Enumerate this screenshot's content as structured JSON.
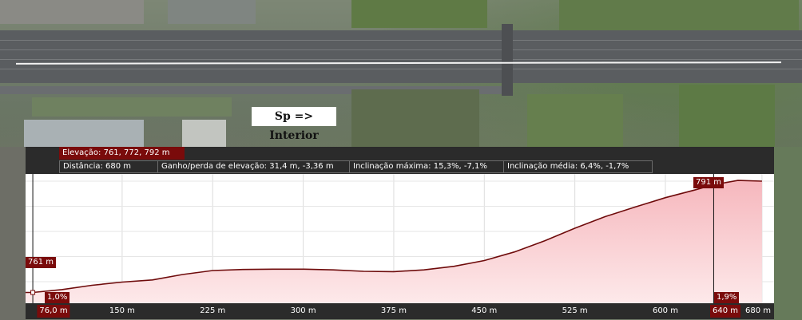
{
  "route_caption": "Sp  => Interior",
  "header": {
    "elevation": "Elevação: 761, 772, 792 m",
    "distance": "Distância: 680 m",
    "gain": "Ganho/perda de elevação: 31,4 m, -3,36 m",
    "max_slope": "Inclinação máxima: 15,3%, -7,1%",
    "avg_slope": "Inclinação média: 6,4%, -1,7%"
  },
  "markers": {
    "left_elevation": "761 m",
    "left_slope": "1,0%",
    "left_distance": "76,0 m",
    "right_elevation": "791 m",
    "right_slope": "1,9%",
    "right_distance": "640 m"
  },
  "chart_data": {
    "type": "area",
    "xlabel": "",
    "ylabel": "",
    "x_range": [
      70,
      690
    ],
    "x_ticks": [
      "150 m",
      "225 m",
      "300 m",
      "375 m",
      "450 m",
      "525 m",
      "600 m",
      "680 m"
    ],
    "x_tick_values": [
      150,
      225,
      300,
      375,
      450,
      525,
      600,
      680
    ],
    "y_range": [
      758,
      794
    ],
    "grid": true,
    "colors": {
      "line": "#6e0b0b",
      "fill_top": "#f6b7bd",
      "fill_bottom": "#fde9ea"
    },
    "series": [
      {
        "x": [
          76,
          100,
          125,
          150,
          175,
          200,
          225,
          250,
          275,
          300,
          325,
          350,
          375,
          400,
          425,
          450,
          475,
          500,
          525,
          550,
          575,
          600,
          625,
          640,
          660,
          680
        ],
        "y": [
          761.0,
          761.8,
          763.0,
          763.9,
          764.5,
          766.0,
          767.1,
          767.4,
          767.5,
          767.5,
          767.3,
          766.9,
          766.8,
          767.3,
          768.3,
          769.9,
          772.3,
          775.4,
          778.9,
          782.1,
          784.8,
          787.4,
          789.6,
          791.0,
          792.2,
          792.0
        ]
      }
    ]
  }
}
